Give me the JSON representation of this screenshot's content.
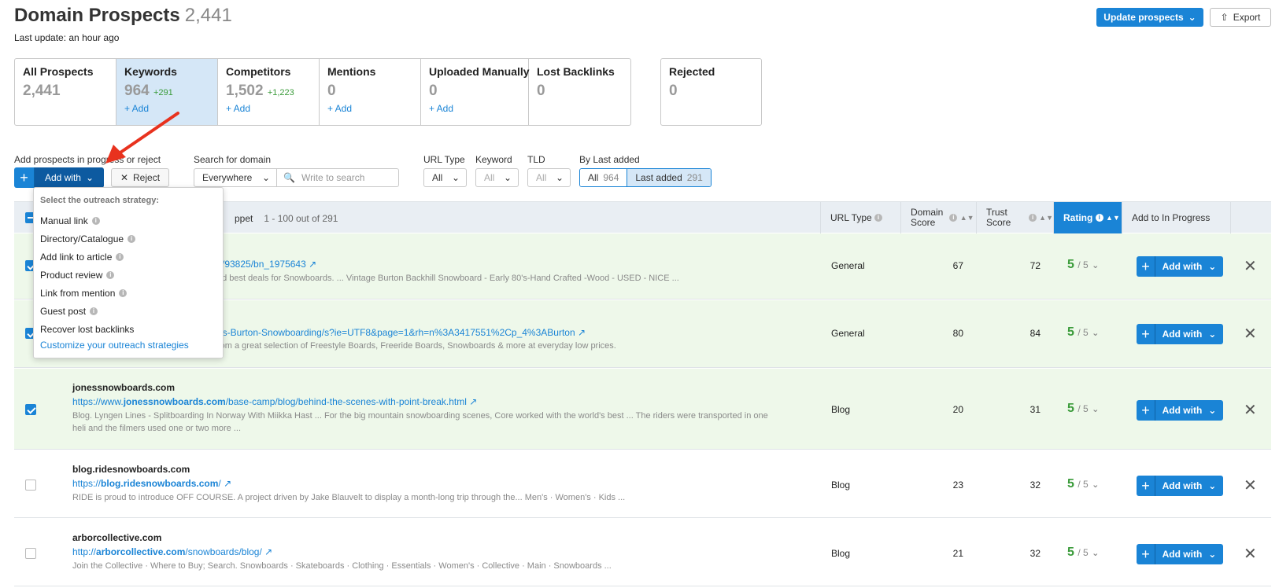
{
  "header": {
    "title": "Domain Prospects",
    "count": "2,441",
    "last_update": "Last update: an hour ago",
    "update_button": "Update prospects",
    "export_button": "Export"
  },
  "tabs": [
    {
      "name": "All Prospects",
      "value": "2,441",
      "delta": "",
      "add": ""
    },
    {
      "name": "Keywords",
      "value": "964",
      "delta": "+291",
      "add": "+ Add"
    },
    {
      "name": "Competitors",
      "value": "1,502",
      "delta": "+1,223",
      "add": "+ Add"
    },
    {
      "name": "Mentions",
      "value": "0",
      "delta": "",
      "add": "+ Add"
    },
    {
      "name": "Uploaded Manually",
      "value": "0",
      "delta": "",
      "add": "+ Add"
    },
    {
      "name": "Lost Backlinks",
      "value": "0",
      "delta": "",
      "add": ""
    }
  ],
  "rejected_tab": {
    "name": "Rejected",
    "value": "0"
  },
  "filters": {
    "add_label": "Add prospects in progress or reject",
    "add_with": "Add with",
    "reject": "Reject",
    "search_label": "Search for domain",
    "search_scope": "Everywhere",
    "search_placeholder": "Write to search",
    "url_type_label": "URL Type",
    "url_type_value": "All",
    "keyword_label": "Keyword",
    "keyword_value": "All",
    "tld_label": "TLD",
    "tld_value": "All",
    "by_last_label": "By Last added",
    "seg_all": "All",
    "seg_all_count": "964",
    "seg_last": "Last added",
    "seg_last_count": "291"
  },
  "table_header": {
    "snippet_label": "ppet",
    "range": "1 - 100 out of 291",
    "url_type": "URL Type",
    "domain_score": "Domain Score",
    "trust_score": "Trust Score",
    "rating": "Rating",
    "add_to": "Add to In Progress"
  },
  "dropdown": {
    "heading": "Select the outreach strategy:",
    "items": [
      "Manual link",
      "Directory/Catalogue",
      "Add link to article",
      "Product review",
      "Link from mention",
      "Guest post",
      "Recover lost backlinks"
    ],
    "customize": "Customize your outreach strategies"
  },
  "rows": [
    {
      "domain": "",
      "url_pre": "",
      "url_bold": "",
      "url_post": "s/93825/bn_1975643",
      "snippet": "nd best deals for Snowboards. ... Vintage Burton Backhill Snowboard - Early 80's-Hand Crafted -Wood - USED - NICE ...",
      "url_type": "General",
      "domain_score": "67",
      "trust_score": "72",
      "rating": "5",
      "rating_of": "/ 5",
      "add_with": "Add with",
      "checked": true
    },
    {
      "domain": "",
      "url_pre": "",
      "url_bold": "",
      "url_post": "ds-Burton-Snowboarding/s?ie=UTF8&page=1&rh=n%3A3417551%2Cp_4%3ABurton",
      "snippet": "rom a great selection of Freestyle Boards, Freeride Boards, Snowboards & more at everyday low prices.",
      "url_type": "General",
      "domain_score": "80",
      "trust_score": "84",
      "rating": "5",
      "rating_of": "/ 5",
      "add_with": "Add with",
      "checked": true
    },
    {
      "domain": "jonessnowboards.com",
      "url_pre": "https://www.",
      "url_bold": "jonessnowboards.com",
      "url_post": "/base-camp/blog/behind-the-scenes-with-point-break.html",
      "snippet": "Blog. Lyngen Lines - Splitboarding In Norway With Miikka Hast ... For the big mountain snowboarding scenes, Core worked with the world's best ... The riders were transported in one heli and the filmers used one or two more ...",
      "url_type": "Blog",
      "domain_score": "20",
      "trust_score": "31",
      "rating": "5",
      "rating_of": "/ 5",
      "add_with": "Add with",
      "checked": true
    },
    {
      "domain": "blog.ridesnowboards.com",
      "url_pre": "https://",
      "url_bold": "blog.ridesnowboards.com",
      "url_post": "/",
      "snippet": "RIDE is proud to introduce OFF COURSE. A project driven by Jake Blauvelt to display a month-long trip through the... Men's · Women's · Kids ...",
      "url_type": "Blog",
      "domain_score": "23",
      "trust_score": "32",
      "rating": "5",
      "rating_of": "/ 5",
      "add_with": "Add with",
      "checked": false
    },
    {
      "domain": "arborcollective.com",
      "url_pre": "http://",
      "url_bold": "arborcollective.com",
      "url_post": "/snowboards/blog/",
      "snippet": "Join the Collective · Where to Buy; Search. Snowboards · Skateboards · Clothing · Essentials · Women's · Collective · Main · Snowboards ...",
      "url_type": "Blog",
      "domain_score": "21",
      "trust_score": "32",
      "rating": "5",
      "rating_of": "/ 5",
      "add_with": "Add with",
      "checked": false
    }
  ],
  "colors": {
    "accent": "#1a84d6",
    "dark_accent": "#0d5aa0",
    "selected_row": "#eef8ea",
    "rating_green": "#3a9b3a",
    "arrow": "#e8321e"
  }
}
